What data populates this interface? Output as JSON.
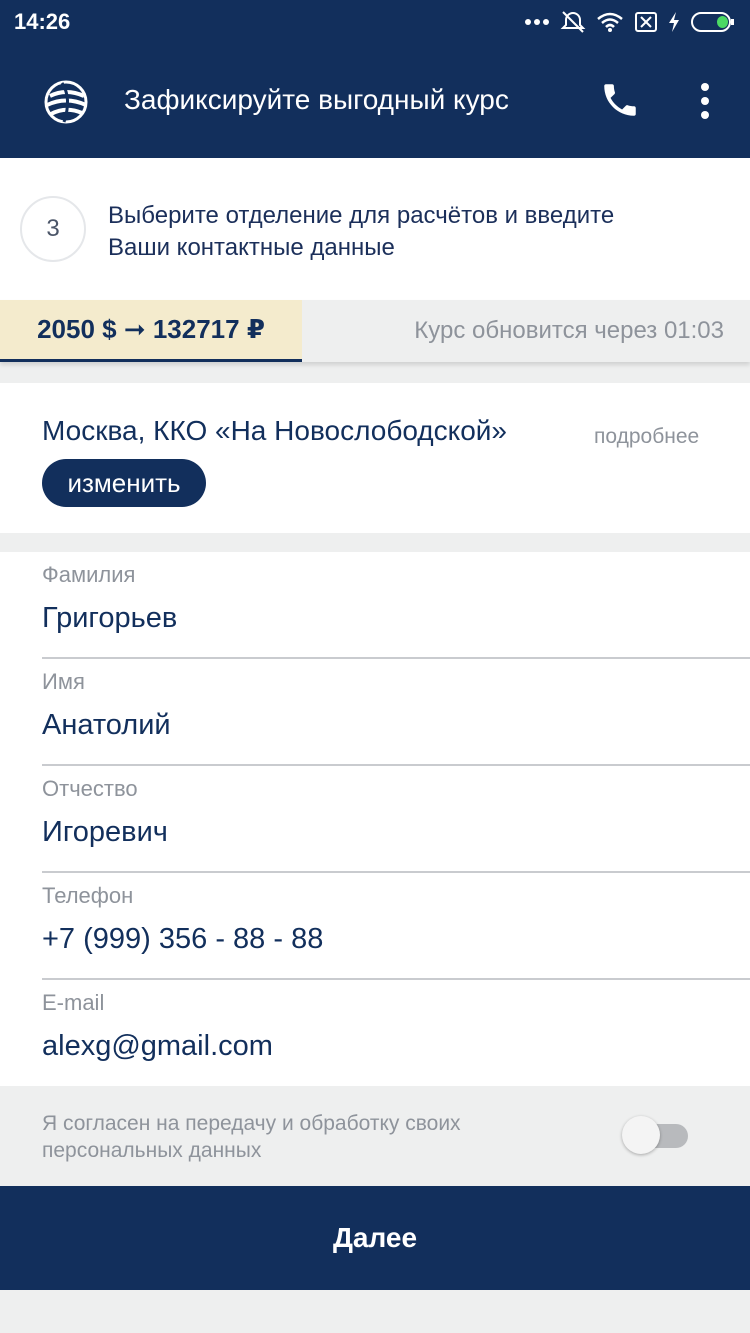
{
  "status_bar": {
    "time": "14:26",
    "icons": [
      "more-dots-icon",
      "alarm-off-icon",
      "wifi-icon",
      "sim-off-icon",
      "charging-icon",
      "battery-icon"
    ]
  },
  "app_bar": {
    "title": "Зафиксируйте выгодный курс",
    "logo_icon": "globe-logo-icon",
    "phone_icon": "phone-icon",
    "menu_icon": "more-vertical-icon"
  },
  "step": {
    "number": "3",
    "line1": "Выберите отделение для расчётов и введите",
    "line2": "Ваши контактные данные"
  },
  "rate": {
    "conversion": "2050 $ ➞ 132717 ₽",
    "timer_text": "Курс обновится через 01:03"
  },
  "branch": {
    "name": "Москва, ККО «На Новослободской»",
    "details_link": "подробнее",
    "change_button": "изменить"
  },
  "form": {
    "fields": [
      {
        "label": "Фамилия",
        "value": "Григорьев"
      },
      {
        "label": "Имя",
        "value": "Анатолий"
      },
      {
        "label": "Отчество",
        "value": "Игоревич"
      },
      {
        "label": "Телефон",
        "value": "+7 (999) 356 - 88 - 88"
      },
      {
        "label": "E-mail",
        "value": "alexg@gmail.com"
      }
    ]
  },
  "consent": {
    "line1": "Я согласен на передачу и обработку своих",
    "line2": "персональных данных",
    "enabled": false
  },
  "next_button": "Далее",
  "colors": {
    "primary": "#122f5c",
    "rate_highlight": "#f4ebcd",
    "muted_text": "#8e939b",
    "background": "#eeefef",
    "battery_charge": "#4cd964"
  }
}
